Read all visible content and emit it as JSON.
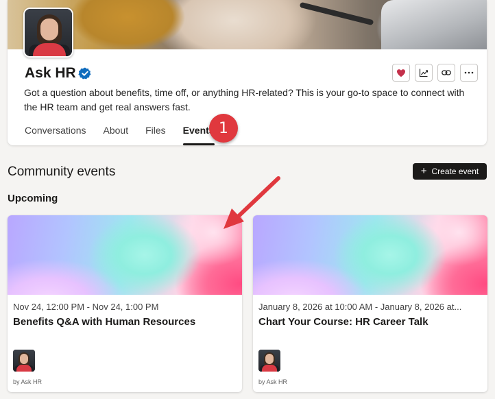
{
  "community": {
    "name": "Ask HR",
    "description": "Got a question about benefits, time off, or anything HR-related? This is your go-to space to connect with the HR team and get real answers fast.",
    "tabs": [
      {
        "label": "Conversations",
        "active": false
      },
      {
        "label": "About",
        "active": false
      },
      {
        "label": "Files",
        "active": false
      },
      {
        "label": "Events",
        "active": true
      }
    ],
    "actions": [
      "heart-icon",
      "analytics-icon",
      "link-icon",
      "more-icon"
    ]
  },
  "callout": {
    "step_number": "1"
  },
  "events_section": {
    "title": "Community events",
    "create_button_label": "Create event",
    "subsection": "Upcoming",
    "events": [
      {
        "date": "Nov 24, 12:00 PM - Nov 24, 1:00 PM",
        "title": "Benefits Q&A with Human Resources",
        "host": "by Ask HR"
      },
      {
        "date": "January 8, 2026 at 10:00 AM - January 8, 2026 at...",
        "title": "Chart Your Course: HR Career Talk",
        "host": "by Ask HR"
      }
    ]
  },
  "colors": {
    "accent_dark": "#1b1a19",
    "callout_red": "#e0383e",
    "verified_blue": "#0f6cbd",
    "heart_red": "#c4314b"
  }
}
